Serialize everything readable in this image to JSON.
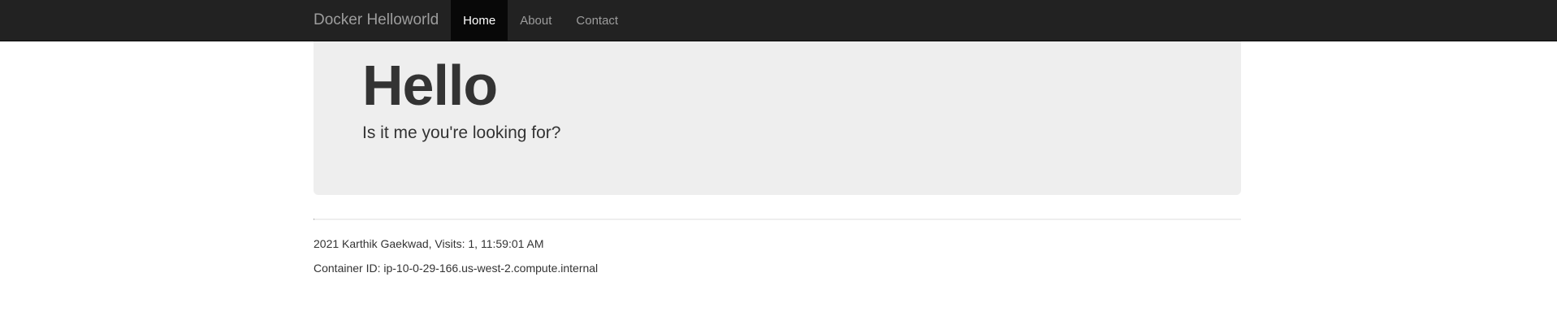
{
  "navbar": {
    "brand": "Docker Helloworld",
    "items": [
      {
        "label": "Home",
        "active": true
      },
      {
        "label": "About",
        "active": false
      },
      {
        "label": "Contact",
        "active": false
      }
    ]
  },
  "jumbotron": {
    "title": "Hello",
    "subtitle": "Is it me you're looking for?"
  },
  "footer": {
    "line1": "2021 Karthik Gaekwad, Visits: 1,  11:59:01 AM",
    "line2": "Container ID: ip-10-0-29-166.us-west-2.compute.internal"
  },
  "colors": {
    "navbar_bg": "#222222",
    "active_item_bg": "#080808",
    "jumbotron_bg": "#eeeeee"
  }
}
